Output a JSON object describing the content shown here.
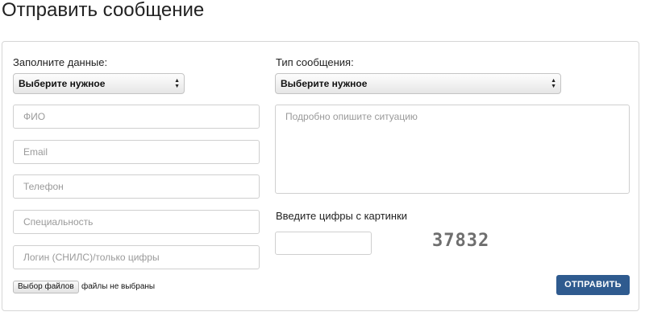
{
  "page": {
    "title": "Отправить сообщение"
  },
  "form": {
    "left": {
      "label": "Заполните данные:",
      "select_value": "Выберите нужное",
      "fields": [
        {
          "placeholder": "ФИО"
        },
        {
          "placeholder": "Email"
        },
        {
          "placeholder": "Телефон"
        },
        {
          "placeholder": "Специальность"
        },
        {
          "placeholder": "Логин (СНИЛС)/только цифры"
        }
      ]
    },
    "right": {
      "label": "Тип сообщения:",
      "select_value": "Выберите нужное",
      "message_placeholder": "Подробно опишите ситуацию",
      "captcha_label": "Введите цифры с картинки",
      "captcha_value": "",
      "captcha_image_text": "37832"
    },
    "file": {
      "button_label": "Выбор файлов",
      "status": "файлы не выбраны"
    },
    "submit_label": "ОТПРАВИТЬ"
  }
}
